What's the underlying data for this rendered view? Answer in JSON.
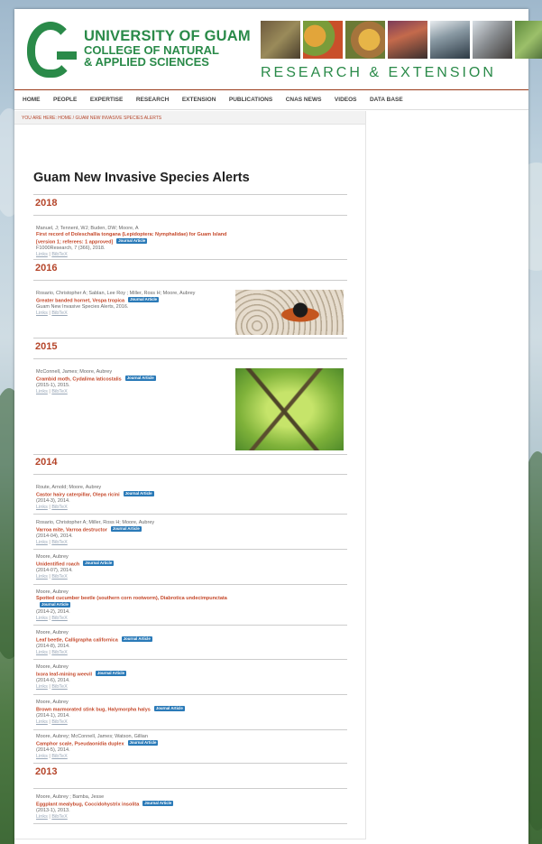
{
  "header": {
    "title_line1": "UNIVERSITY OF GUAM",
    "title_line2": "COLLEGE OF NATURAL",
    "title_line3": "& APPLIED SCIENCES",
    "research_extension": "RESEARCH & EXTENSION"
  },
  "nav": [
    "HOME",
    "PEOPLE",
    "EXPERTISE",
    "RESEARCH",
    "EXTENSION",
    "PUBLICATIONS",
    "CNAS NEWS",
    "VIDEOS",
    "DATA BASE"
  ],
  "breadcrumb": "YOU ARE HERE: HOME / GUAM NEW INVASIVE SPECIES ALERTS",
  "page_title": "Guam New Invasive Species Alerts",
  "badge_label": "Journal Article",
  "links_label": "Links",
  "bibtex_label": "BibTeX",
  "years": [
    "2018",
    "2016",
    "2015",
    "2014",
    "2013"
  ],
  "entries": [
    {
      "authors": "Manuel, J; Tennent, WJ; Buden, DW; Moore, A",
      "title": "First record of Doleschallia tongana (Lepidoptera: Nymphalidae) for Guam Island [version 1; referees: 1 approved]",
      "meta": "F1000Research, 7 (366), 2018."
    },
    {
      "authors": "Rosario, Christopher A; Sablan, Lee Roy ; Miller, Ross H; Moore, Aubrey",
      "title": "Greater banded hornet, Vespa tropica",
      "meta": "Guam New Invasive Species Alerts, 2016."
    },
    {
      "authors": "McConnell, James; Moore, Aubrey",
      "title": "Crambid moth, Cydalima laticostalis",
      "meta": "(2015-1), 2015."
    },
    {
      "authors": "Route, Arnold; Moore, Aubrey",
      "title": "Castor hairy caterpillar, Olepa ricini",
      "meta": "(2014-3), 2014."
    },
    {
      "authors": "Rosario, Christopher A; Miller, Ross H; Moore, Aubrey",
      "title": "Varroa mite, Varroa destructor",
      "meta": "(2014-04), 2014."
    },
    {
      "authors": "Moore, Aubrey",
      "title": "Unidentified roach",
      "meta": "(2014-07), 2014."
    },
    {
      "authors": "Moore, Aubrey",
      "title": "Spotted cucumber beetle (southern corn rootworm), Diabrotica undecimpunctata",
      "meta": "(2014-2), 2014."
    },
    {
      "authors": "Moore, Aubrey",
      "title": "Leaf beetle, Calligrapha californica",
      "meta": "(2014-8), 2014."
    },
    {
      "authors": "Moore, Aubrey",
      "title": "Ixora leaf-mining weevil",
      "meta": "(2014-6), 2014."
    },
    {
      "authors": "Moore, Aubrey",
      "title": "Brown marmorated stink bug, Halymorpha halys",
      "meta": "(2014-1), 2014."
    },
    {
      "authors": "Moore, Aubrey; McConnell, James; Watson, Gillian",
      "title": "Camphor scale, Pseudaonidia duplex",
      "meta": "(2014-5), 2014."
    },
    {
      "authors": "Moore, Aubrey ; Bamba, Jesse",
      "title": "Eggplant mealybug, Coccidohystrix insolita",
      "meta": "(2013-1), 2013."
    }
  ],
  "colors": {
    "accent_green": "#2a8a49",
    "title_red": "#c5482a",
    "badge_blue": "#2a7ab8"
  }
}
